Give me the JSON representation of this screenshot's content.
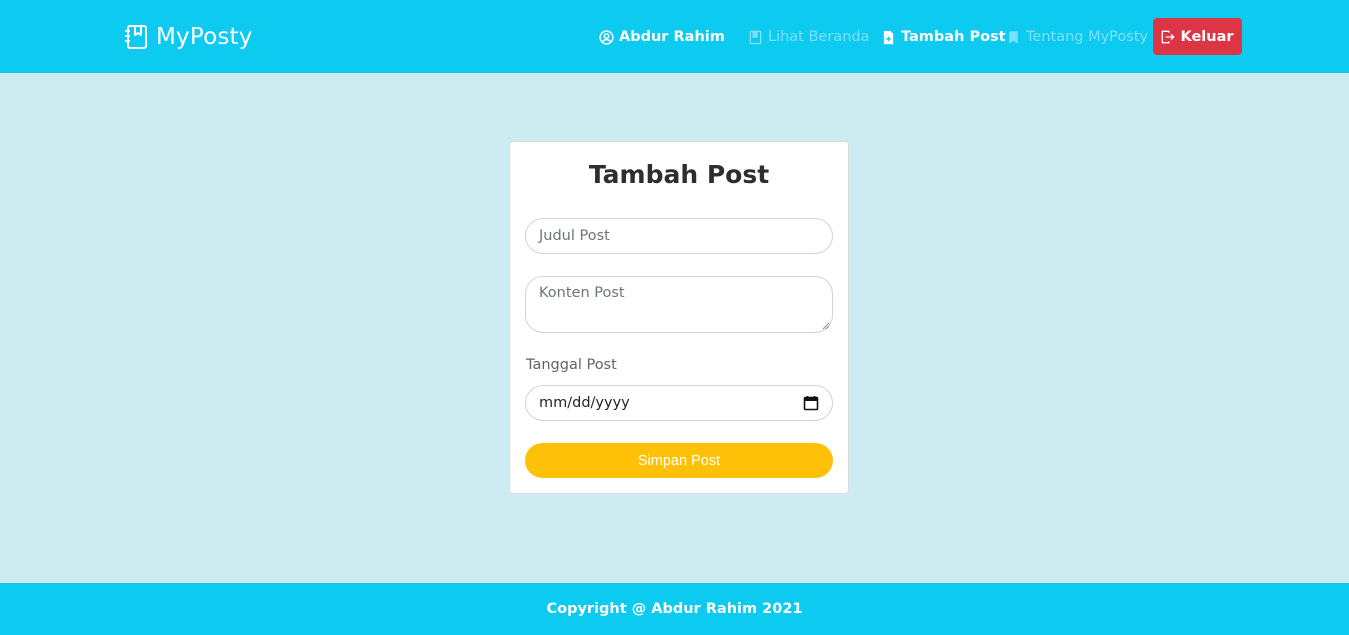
{
  "navbar": {
    "brand": "MyPosty",
    "brand_icon": "notebook-icon",
    "user_name": "Abdur Rahim",
    "user_icon": "user-circle-icon",
    "links": [
      {
        "label": "Lihat Beranda",
        "icon": "book-icon"
      },
      {
        "label": "Tambah Post",
        "icon": "file-plus-icon"
      },
      {
        "label": "Tentang MyPosty",
        "icon": "bookmark-icon"
      }
    ],
    "logout_label": "Keluar",
    "logout_icon": "logout-icon"
  },
  "form": {
    "title": "Tambah Post",
    "title_placeholder": "Judul Post",
    "content_placeholder": "Konten Post",
    "date_label": "Tanggal Post",
    "date_value": "mm/dd/yyyy",
    "submit_label": "Simpan Post"
  },
  "footer": {
    "text": "Copyright @ Abdur Rahim 2021"
  },
  "colors": {
    "primary": "#0dcaf0",
    "background": "#cdecf1",
    "danger": "#dc3545",
    "warning": "#ffc107"
  }
}
